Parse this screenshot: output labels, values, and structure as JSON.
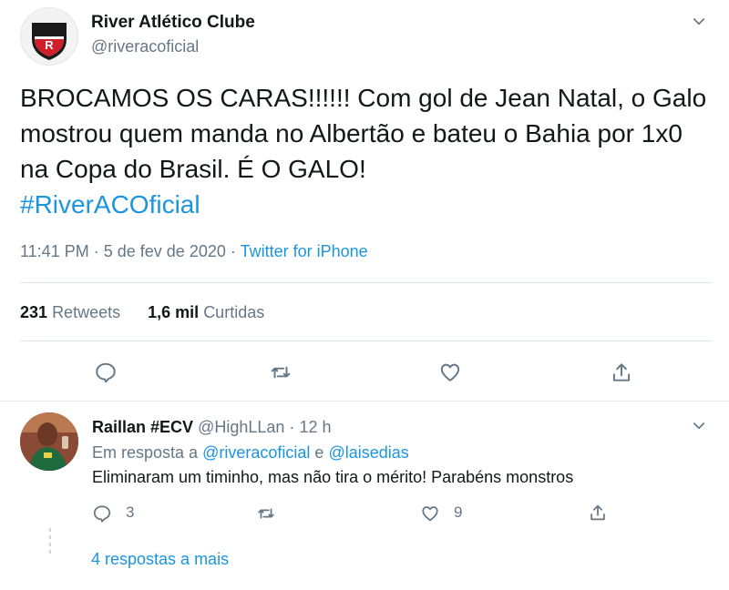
{
  "tweet": {
    "author_name": "River Atlético Clube",
    "author_handle": "@riveracoficial",
    "text": "BROCAMOS OS CARAS!!!!!! Com gol de Jean Natal, o Galo mostrou quem manda no Albertão e bateu o Bahia por 1x0 na Copa do Brasil. É O GALO!",
    "hashtag": "#RiverACOficial",
    "time": "11:41 PM",
    "date": "5 de fev de 2020",
    "separator": "·",
    "source": "Twitter for iPhone",
    "retweets_count": "231",
    "retweets_label": "Retweets",
    "likes_count": "1,6 mil",
    "likes_label": "Curtidas"
  },
  "reply": {
    "author_name": "Raillan #ECV",
    "author_handle": "@HighLLan",
    "separator": "·",
    "time": "12 h",
    "in_reply_prefix": "Em resposta a",
    "in_reply_user1": "@riveracoficial",
    "in_reply_and": "e",
    "in_reply_user2": "@laisedias",
    "text": "Eliminaram um timinho, mas não tira o mérito! Parabéns monstros",
    "reply_count": "3",
    "like_count": "9",
    "more_replies": "4 respostas a mais"
  },
  "icons": {
    "caret": "chevron-down-icon",
    "reply": "comment-icon",
    "retweet": "retweet-icon",
    "like": "heart-icon",
    "share": "share-icon"
  },
  "colors": {
    "link": "#1b95e0",
    "muted": "#657786",
    "text": "#14171a",
    "divider": "#e1e8ed"
  }
}
